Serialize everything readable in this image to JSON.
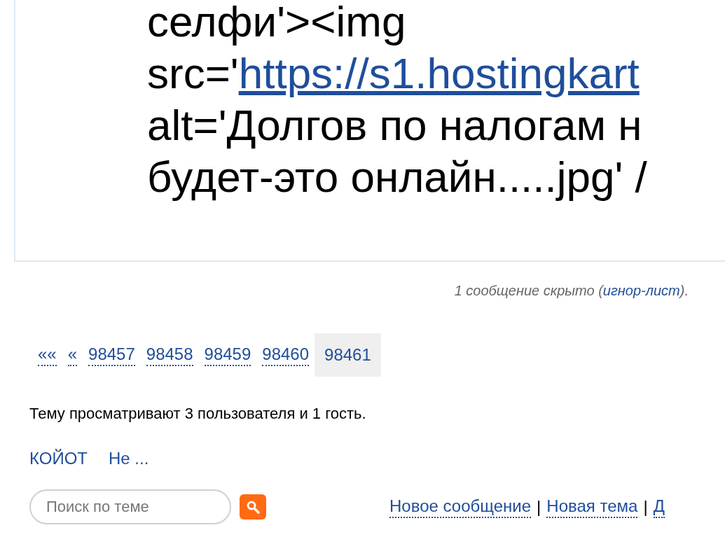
{
  "post": {
    "lines": [
      {
        "prefix": "селфи'><img"
      },
      {
        "prefix": "src='",
        "link": "https://s1.hostingkart"
      },
      {
        "prefix": "alt='Долгов по налогам н"
      },
      {
        "prefix": "будет-это онлайн.....jpg' /"
      }
    ]
  },
  "hidden_note": {
    "before": "1 сообщение скрыто (",
    "link": "игнор-лист",
    "after": ")."
  },
  "pagination": [
    {
      "label": "««",
      "selected": false
    },
    {
      "label": "«",
      "selected": false
    },
    {
      "label": "98457",
      "selected": false
    },
    {
      "label": "98458",
      "selected": false
    },
    {
      "label": "98459",
      "selected": false
    },
    {
      "label": "98460",
      "selected": false
    },
    {
      "label": "98461",
      "selected": true
    }
  ],
  "viewers": {
    "text": "Тему просматривают 3 пользователя и 1 гость.",
    "users": [
      "КОЙОТ",
      "Не ..."
    ]
  },
  "search": {
    "placeholder": "Поиск по теме"
  },
  "actions": [
    "Новое сообщение",
    "Новая тема",
    "Д"
  ],
  "action_separator": "|"
}
